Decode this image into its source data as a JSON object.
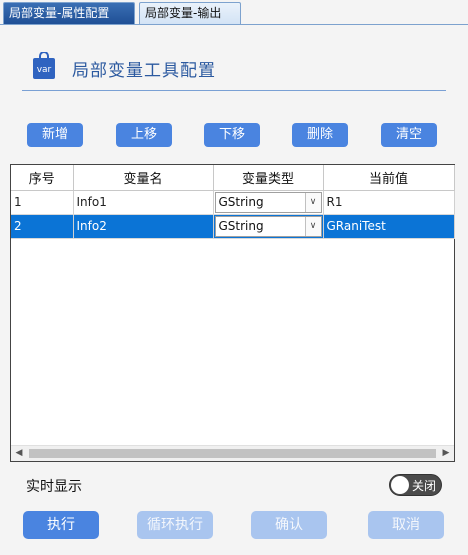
{
  "tabs": [
    {
      "label": "局部变量-属性配置",
      "active": true
    },
    {
      "label": "局部变量-输出",
      "active": false
    }
  ],
  "header": {
    "icon_text": "var",
    "title": "局部变量工具配置"
  },
  "toolbar": {
    "add": "新增",
    "move_up": "上移",
    "move_down": "下移",
    "delete": "删除",
    "clear": "清空"
  },
  "table": {
    "columns": [
      "序号",
      "变量名",
      "变量类型",
      "当前值"
    ],
    "rows": [
      {
        "index": "1",
        "name": "Info1",
        "type": "GString",
        "value": "R1",
        "selected": false
      },
      {
        "index": "2",
        "name": "Info2",
        "type": "GString",
        "value": "GRaniTest",
        "selected": true
      }
    ]
  },
  "realtime": {
    "label": "实时显示",
    "toggle_label": "关闭",
    "on": false
  },
  "footer": {
    "execute": "执行",
    "loop_execute": "循环执行",
    "confirm": "确认",
    "cancel": "取消"
  },
  "colors": {
    "accent": "#4a84e0",
    "selected_row": "#0b74d6",
    "title": "#2c5aa0"
  }
}
